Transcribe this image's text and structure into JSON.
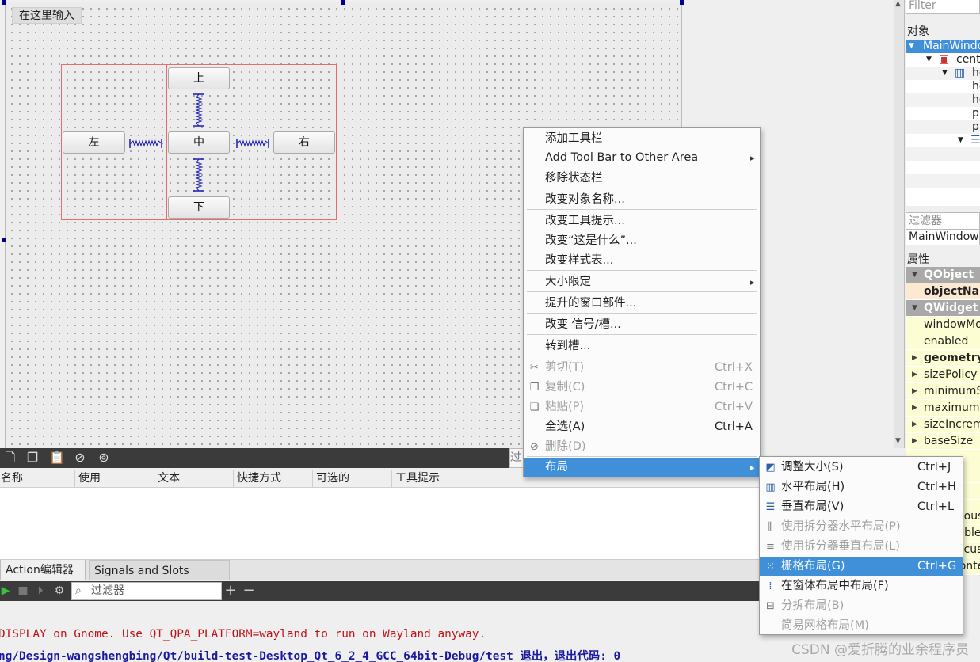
{
  "canvas": {
    "menubar_placeholder": "在这里输入"
  },
  "layout_buttons": {
    "up": "上",
    "left": "左",
    "center": "中",
    "right": "右",
    "down": "下"
  },
  "action_editor": {
    "filter_stub": "过",
    "columns": [
      "名称",
      "使用",
      "文本",
      "快捷方式",
      "可选的",
      "工具提示"
    ]
  },
  "dock_tabs": {
    "action_editor": "Action编辑器",
    "signals_slots": "Signals and Slots Editor"
  },
  "issues": {
    "filter_placeholder": "过滤器"
  },
  "output": {
    "line1": "DISPLAY on Gnome. Use QT_QPA_PLATFORM=wayland to run on Wayland anyway.",
    "line2": "ng/Design-wangshengbing/Qt/build-test-Desktop_Qt_6_2_4_GCC_64bit-Debug/test 退出，退出代码: 0"
  },
  "watermark": "CSDN @爱折腾的业余程序员",
  "object_inspector": {
    "filter_placeholder": "Filter",
    "title": "对象",
    "rows": [
      "MainWindow",
      "centralwidget",
      "horizontalLayout",
      "horizontalSpacer",
      "horizontalSpacer_2",
      "pushButton",
      "pushButton_2",
      "verticalLayout"
    ]
  },
  "property_editor": {
    "filter_placeholder": "过滤器",
    "class_label": "MainWindow : QMainWindow",
    "title": "属性",
    "rows": [
      "QObject",
      "objectName",
      "QWidget",
      "windowModality",
      "enabled",
      "geometry",
      "sizePolicy",
      "minimumSize",
      "maximumSize",
      "sizeIncrement",
      "baseSize"
    ],
    "lower_rows": [
      "mouseTracking",
      "tabletTracking",
      "focusPolicy",
      "contextMenuPolicy"
    ]
  },
  "context_menu": {
    "items": [
      {
        "label": "添加工具栏"
      },
      {
        "label": "Add Tool Bar to Other Area",
        "submenu": true
      },
      {
        "label": "移除状态栏"
      },
      {
        "label": "改变对象名称..."
      },
      {
        "label": "改变工具提示..."
      },
      {
        "label": "改变“这是什么”..."
      },
      {
        "label": "改变样式表..."
      },
      {
        "label": "大小限定",
        "submenu": true
      },
      {
        "label": "提升的窗口部件..."
      },
      {
        "label": "改变 信号/槽..."
      },
      {
        "label": "转到槽..."
      },
      {
        "label": "剪切(T)",
        "shortcut": "Ctrl+X",
        "icon": "scissors-icon",
        "disabled": true
      },
      {
        "label": "复制(C)",
        "shortcut": "Ctrl+C",
        "icon": "copy-icon",
        "disabled": true
      },
      {
        "label": "粘贴(P)",
        "shortcut": "Ctrl+V",
        "icon": "paste-icon",
        "disabled": true
      },
      {
        "label": "全选(A)",
        "shortcut": "Ctrl+A"
      },
      {
        "label": "删除(D)",
        "icon": "delete-icon",
        "disabled": true
      },
      {
        "label": "布局",
        "submenu": true,
        "highlighted": true
      }
    ]
  },
  "layout_submenu": {
    "items": [
      {
        "label": "调整大小(S)",
        "shortcut": "Ctrl+J",
        "icon": "adjust-size-icon"
      },
      {
        "label": "水平布局(H)",
        "shortcut": "Ctrl+H",
        "icon": "horizontal-layout-icon"
      },
      {
        "label": "垂直布局(V)",
        "shortcut": "Ctrl+L",
        "icon": "vertical-layout-icon"
      },
      {
        "label": "使用拆分器水平布局(P)",
        "icon": "horizontal-splitter-icon",
        "disabled": true
      },
      {
        "label": "使用拆分器垂直布局(L)",
        "icon": "vertical-splitter-icon",
        "disabled": true
      },
      {
        "label": "栅格布局(G)",
        "shortcut": "Ctrl+G",
        "icon": "grid-layout-icon",
        "highlighted": true
      },
      {
        "label": "在窗体布局中布局(F)",
        "icon": "form-layout-icon"
      },
      {
        "label": "分拆布局(B)",
        "icon": "break-layout-icon",
        "disabled": true
      },
      {
        "label": "简易网格布局(M)",
        "disabled": true
      }
    ]
  },
  "colors": {
    "accent": "#3f8fd9",
    "layout_frame": "#e07070",
    "spacer": "#1a1ab8",
    "output_error": "#c0141b",
    "output_info": "#1a1aa0"
  }
}
